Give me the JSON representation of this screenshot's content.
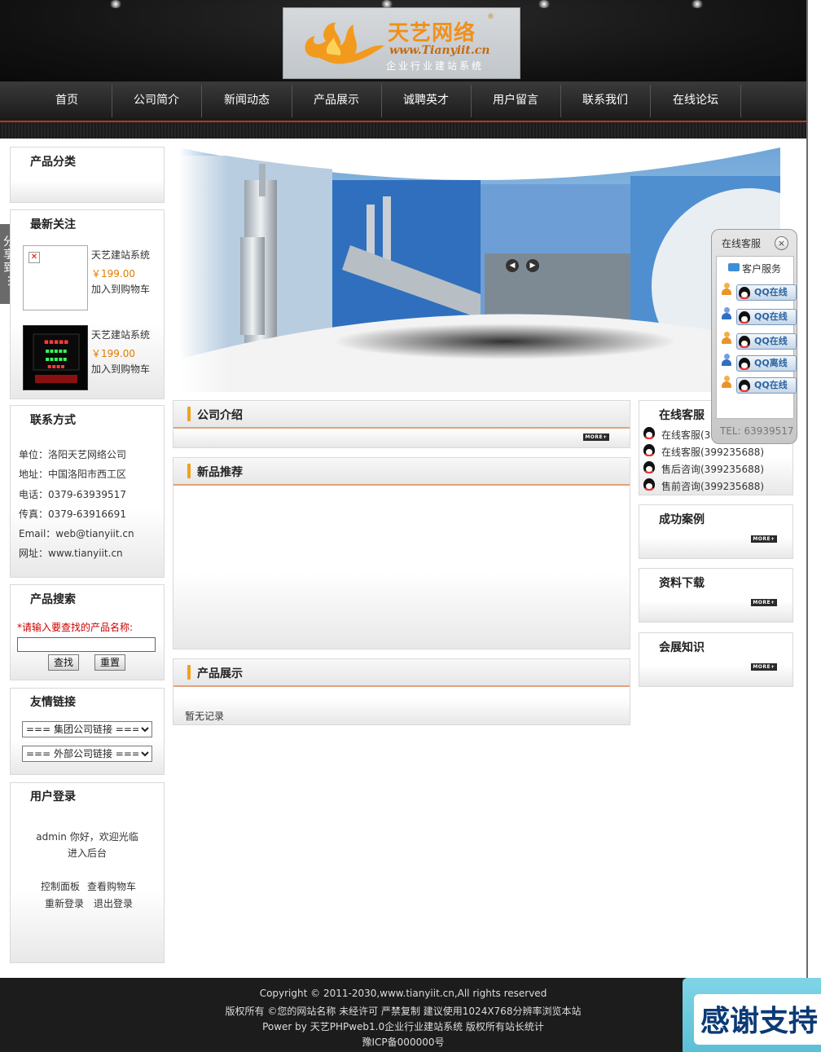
{
  "header": {
    "logo_title": "天艺网络",
    "logo_url": "www.Tianyiit.cn",
    "logo_sub": "企业行业建站系统",
    "logo_mark": "®"
  },
  "nav": {
    "items": [
      "首页",
      "公司简介",
      "新闻动态",
      "产品展示",
      "诚聘英才",
      "用户留言",
      "联系我们",
      "在线论坛"
    ]
  },
  "share": {
    "label": "分享到",
    "dots": "⋮"
  },
  "left": {
    "category": {
      "title": "产品分类"
    },
    "latest": {
      "title": "最新关注",
      "products": [
        {
          "name": "天艺建站系统",
          "price": "￥199.00",
          "cart": "加入到购物车"
        },
        {
          "name": "天艺建站系统",
          "price": "￥199.00",
          "cart": "加入到购物车"
        }
      ]
    },
    "contact": {
      "title": "联系方式",
      "lines": [
        "单位：洛阳天艺网络公司",
        "地址：中国洛阳市西工区",
        "电话：0379-63939517",
        "传真：0379-63916691",
        "Email：web@tianyiit.cn",
        "网址：www.tianyiit.cn"
      ]
    },
    "search": {
      "title": "产品搜索",
      "hint": "*请输入要查找的产品名称:",
      "search_btn": "查找",
      "reset_btn": "重置",
      "value": ""
    },
    "links": {
      "title": "友情链接",
      "group": "===  集团公司链接  ===",
      "external": "===  外部公司链接  ==="
    },
    "login": {
      "title": "用户登录",
      "welcome": "admin 你好，欢迎光临",
      "admin": "进入后台",
      "panel": "控制面板",
      "cart": "查看购物车",
      "relogin": "重新登录",
      "logout": "退出登录"
    }
  },
  "center": {
    "intro": {
      "title": "公司介绍",
      "more": "MORE+"
    },
    "newproducts": {
      "title": "新品推荐"
    },
    "products": {
      "title": "产品展示",
      "empty": "暂无记录"
    }
  },
  "right": {
    "service": {
      "title": "在线客服",
      "items": [
        "在线客服(399235688)",
        "在线客服(399235688)",
        "售后咨询(399235688)",
        "售前咨询(399235688)"
      ]
    },
    "cases": {
      "title": "成功案例",
      "more": "MORE+"
    },
    "downloads": {
      "title": "资料下载",
      "more": "MORE+"
    },
    "knowledge": {
      "title": "会展知识",
      "more": "MORE+"
    }
  },
  "qq": {
    "title": "在线客服",
    "close": "×",
    "folder": "客户服务",
    "buttons": [
      "QQ在线",
      "QQ在线",
      "QQ在线",
      "QQ离线",
      "QQ在线"
    ],
    "tel": "TEL: 63939517"
  },
  "footer": {
    "lines": [
      "Copyright © 2011-2030,www.tianyiit.cn,All rights reserved",
      "版权所有 ©您的网站名称  未经许可  严禁复制  建议使用1024X768分辨率浏览本站",
      "Power by 天艺PHPweb1.0企业行业建站系统  版权所有站长统计",
      "豫ICP备000000号"
    ],
    "thanks": "感谢支持"
  },
  "colors": {
    "accent": "#f0a020",
    "price": "#e07a00",
    "nav_red": "#b23c1f",
    "hint_red": "#cc0000",
    "qq_blue": "#2b65a3"
  }
}
